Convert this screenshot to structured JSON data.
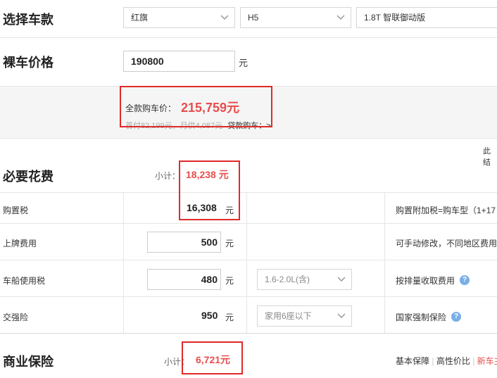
{
  "select_car": {
    "title": "选择车款",
    "brand": "红旗",
    "model": "H5",
    "version": "1.8T 智联御动版"
  },
  "bare_price": {
    "title": "裸车价格",
    "value": "190800",
    "unit": "元"
  },
  "summary": {
    "full_label": "全款购车价：",
    "full_value": "215,759元",
    "loan_info": "首付82,199元，月供4,087元",
    "loan_link": "贷款购车：>",
    "note_right": "此结"
  },
  "required": {
    "title": "必要花费",
    "subtotal_label": "小计：",
    "subtotal_value": "18,238 元",
    "rows": [
      {
        "label": "购置税",
        "value": "16,308",
        "unit": "元",
        "note": "购置附加税=购车型（1+17"
      },
      {
        "label": "上牌费用",
        "value": "500",
        "unit": "元",
        "note": "可手动修改，不同地区费用"
      },
      {
        "label": "车船使用税",
        "value": "480",
        "unit": "元",
        "select": "1.6-2.0L(含)",
        "note": "按排量收取费用"
      },
      {
        "label": "交强险",
        "value": "950",
        "unit": "元",
        "select": "家用6座以下",
        "note": "国家强制保险"
      }
    ]
  },
  "commercial": {
    "title": "商业保险",
    "subtotal_label": "小计：",
    "subtotal_value": "6,721元",
    "links": [
      "基本保障",
      "高性价比",
      "新车主"
    ]
  },
  "colors": {
    "accent_red": "#e84d4d",
    "highlight_box": "#e02a2a",
    "help_icon": "#7aaee6"
  }
}
